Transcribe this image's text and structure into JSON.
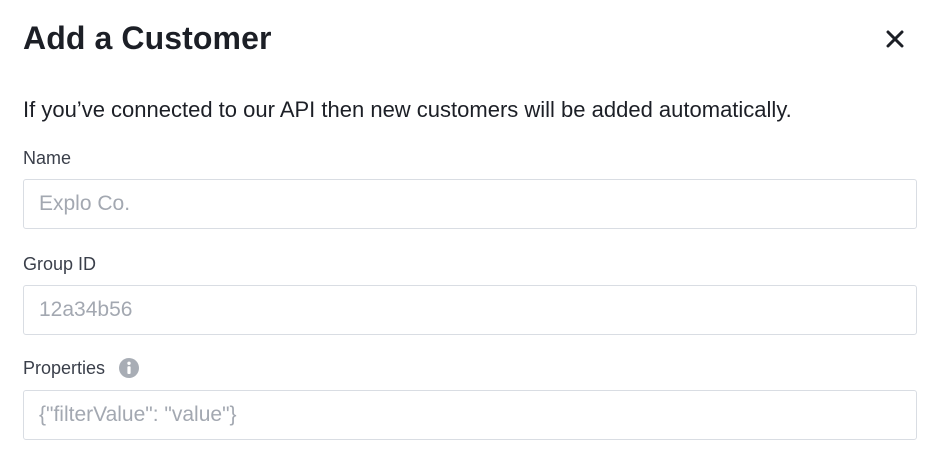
{
  "modal": {
    "title": "Add a Customer",
    "description": "If you’ve connected to our API then new customers will be added automatically."
  },
  "fields": {
    "name": {
      "label": "Name",
      "value": "",
      "placeholder": "Explo Co."
    },
    "group_id": {
      "label": "Group ID",
      "value": "",
      "placeholder": "12a34b56"
    },
    "properties": {
      "label": "Properties",
      "value": "",
      "placeholder": "{\"filterValue\": \"value\"}"
    }
  },
  "icons": {
    "close": "close-icon",
    "info": "info-icon"
  },
  "colors": {
    "text": "#1c1f26",
    "label": "#3a3f4a",
    "placeholder": "#a3a8b1",
    "border": "#d9dde3",
    "info_icon": "#a8adb5"
  }
}
